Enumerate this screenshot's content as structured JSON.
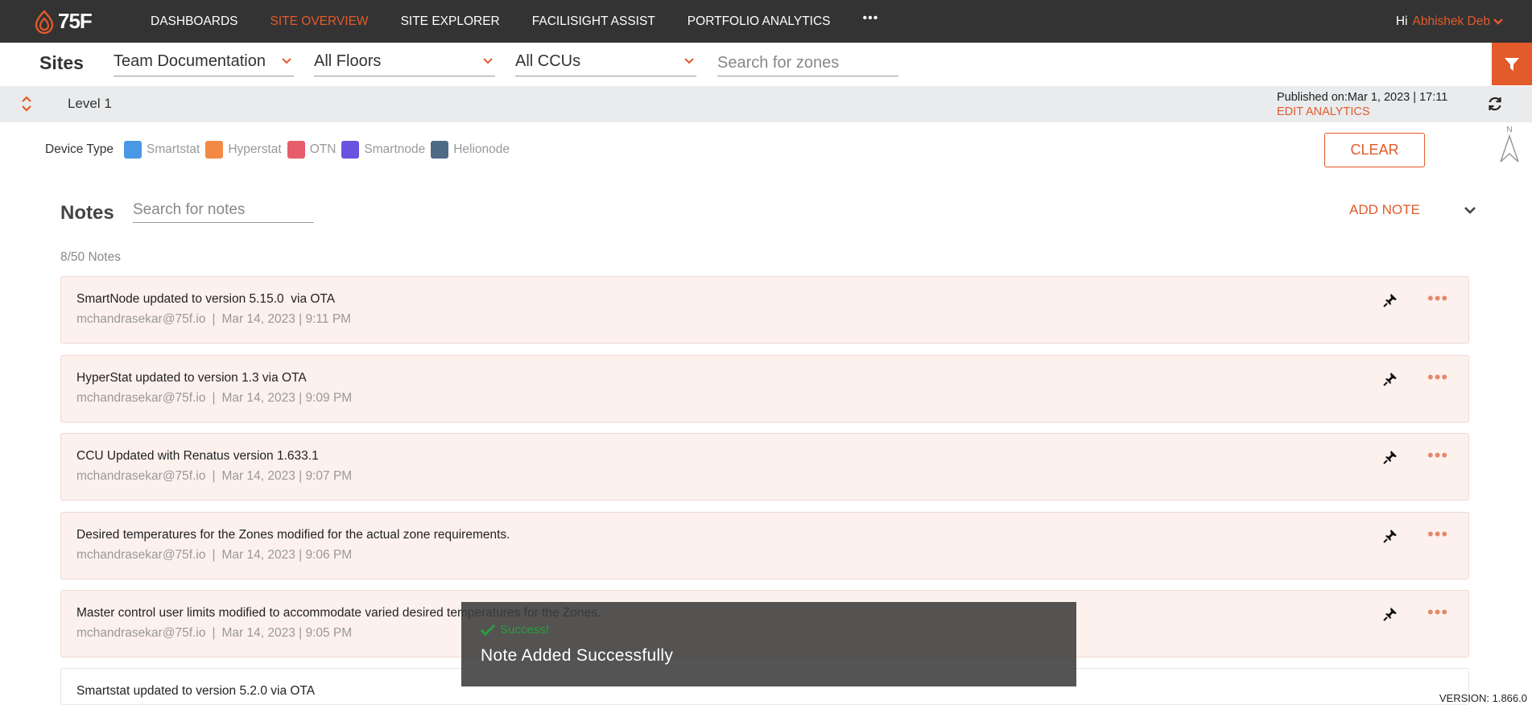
{
  "brand": {
    "name": "75F"
  },
  "nav": {
    "items": [
      {
        "label": "DASHBOARDS",
        "active": false
      },
      {
        "label": "SITE OVERVIEW",
        "active": true
      },
      {
        "label": "SITE EXPLORER",
        "active": false
      },
      {
        "label": "FACILISIGHT ASSIST",
        "active": false
      },
      {
        "label": "PORTFOLIO ANALYTICS",
        "active": false
      }
    ],
    "more_label": "•••"
  },
  "user": {
    "greeting": "Hi",
    "name": "Abhishek Deb"
  },
  "sites": {
    "title": "Sites",
    "site_select": "Team Documentation",
    "floor_select": "All Floors",
    "ccu_select": "All CCUs",
    "zone_search_placeholder": "Search for zones"
  },
  "level": {
    "name": "Level 1",
    "published": "Published on:Mar 1, 2023 | 17:11",
    "edit_analytics": "EDIT ANALYTICS"
  },
  "device_type": {
    "label": "Device Type",
    "items": [
      {
        "label": "Smartstat",
        "color": "#4a97e4"
      },
      {
        "label": "Hyperstat",
        "color": "#f28a45"
      },
      {
        "label": "OTN",
        "color": "#e85d6b"
      },
      {
        "label": "Smartnode",
        "color": "#6a52e0"
      },
      {
        "label": "Helionode",
        "color": "#4e6b86"
      }
    ],
    "clear_label": "CLEAR",
    "compass_n": "N"
  },
  "notes": {
    "title": "Notes",
    "search_placeholder": "Search for notes",
    "add_label": "ADD NOTE",
    "count": "8/50 Notes",
    "items": [
      {
        "title": "SmartNode updated to version 5.15.0  via OTA",
        "author": "mchandrasekar@75f.io",
        "separator": "|",
        "date": "Mar 14, 2023 | 9:11 PM"
      },
      {
        "title": "HyperStat updated to version 1.3 via OTA",
        "author": "mchandrasekar@75f.io",
        "separator": "|",
        "date": "Mar 14, 2023 | 9:09 PM"
      },
      {
        "title": "CCU Updated with Renatus version 1.633.1",
        "author": "mchandrasekar@75f.io",
        "separator": "|",
        "date": "Mar 14, 2023 | 9:07 PM"
      },
      {
        "title": "Desired temperatures for the Zones modified for the actual zone requirements.",
        "author": "mchandrasekar@75f.io",
        "separator": "|",
        "date": "Mar 14, 2023 | 9:06 PM"
      },
      {
        "title": "Master control user limits modified to accommodate varied desired temperatures for the Zones.",
        "author": "mchandrasekar@75f.io",
        "separator": "|",
        "date": "Mar 14, 2023 | 9:05 PM"
      },
      {
        "title": "Smartstat updated to version 5.2.0 via OTA"
      }
    ],
    "more_label": "•••"
  },
  "toast": {
    "status": "Success!",
    "message": "Note Added Successfully"
  },
  "version": "VERSION: 1.866.0",
  "colors": {
    "accent": "#e35a2b",
    "topbar": "#333333",
    "note_bg": "#fdf1ee",
    "success": "#2a9d3a"
  }
}
